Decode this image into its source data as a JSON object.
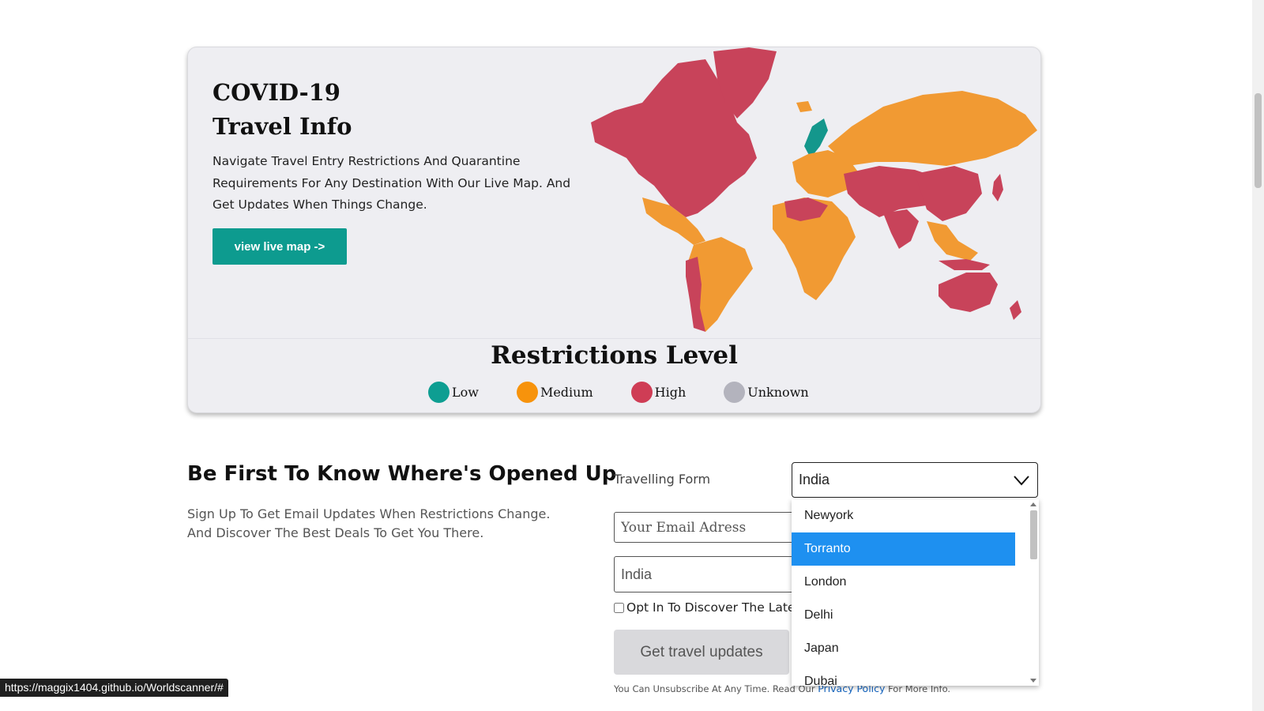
{
  "hero": {
    "title_line1": "COVID-19",
    "title_line2": "Travel Info",
    "description": "Navigate Travel Entry Restrictions And Quarantine Requirements For Any Destination With Our Live Map. And Get Updates When Things Change.",
    "map_button": "view live map ->"
  },
  "legend": {
    "title": "Restrictions Level",
    "items": [
      {
        "label": "Low",
        "color": "#0e9e92"
      },
      {
        "label": "Medium",
        "color": "#f7930c"
      },
      {
        "label": "High",
        "color": "#cf3d55"
      },
      {
        "label": "Unknown",
        "color": "#b3b3bd"
      }
    ]
  },
  "map_colors": {
    "high": "#c8435a",
    "medium": "#f19a33",
    "low": "#14978c"
  },
  "signup": {
    "title": "Be First To Know Where's Opened Up",
    "description": "Sign Up To Get Email Updates When Restrictions Change. And Discover The Best Deals To Get You There."
  },
  "form": {
    "travelling_from_label": "Travelling Form",
    "selected_value": "India",
    "email_placeholder": "Your Email Adress",
    "from_placeholder": "India",
    "optin_label": "Opt In To Discover The Latest",
    "submit_label": "Get travel updates",
    "fine_print_before": "You Can Unsubscribe At Any Time. Read Our ",
    "privacy_link": "Privacy Policy",
    "fine_print_after": " For More Info."
  },
  "dropdown": {
    "options": [
      "Newyork",
      "Torranto",
      "London",
      "Delhi",
      "Japan",
      "Dubai"
    ],
    "highlighted": "Torranto"
  },
  "status_bar": {
    "url": "https://maggix1404.github.io/Worldscanner/#"
  }
}
